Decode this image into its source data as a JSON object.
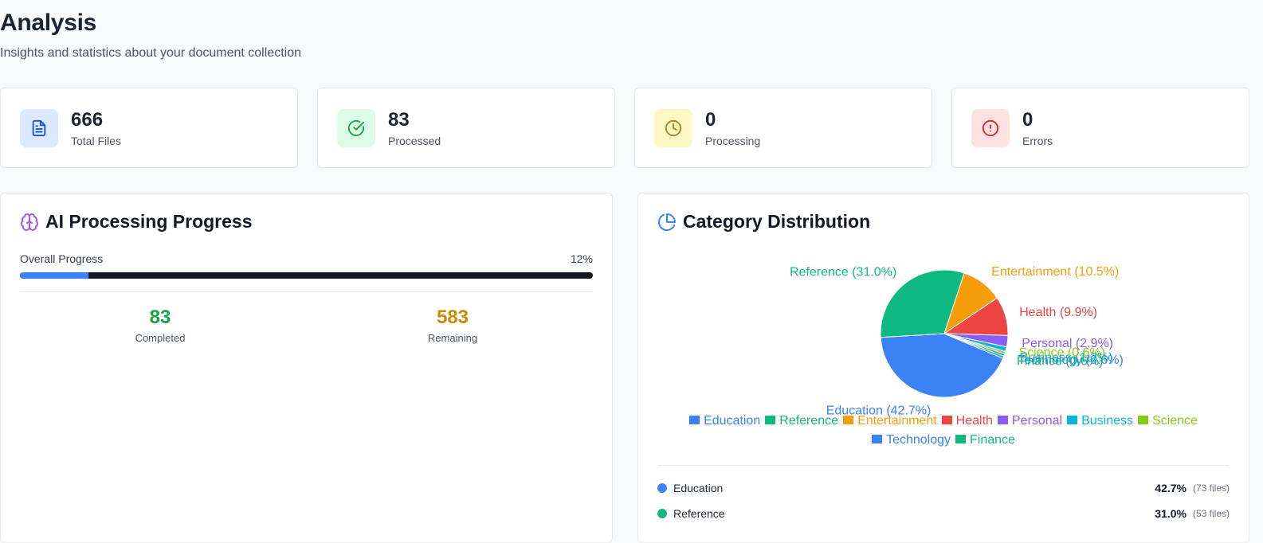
{
  "page": {
    "title": "Analysis",
    "subtitle": "Insights and statistics about your document collection"
  },
  "stats": [
    {
      "value": "666",
      "label": "Total Files",
      "icon": "file-text-icon",
      "color": "#1d4ed8",
      "bg": "#dbeafe"
    },
    {
      "value": "83",
      "label": "Processed",
      "icon": "check-circle-icon",
      "color": "#16a34a",
      "bg": "#dcfce7"
    },
    {
      "value": "0",
      "label": "Processing",
      "icon": "clock-icon",
      "color": "#b7791f",
      "bg": "#fef9c3"
    },
    {
      "value": "0",
      "label": "Errors",
      "icon": "alert-circle-icon",
      "color": "#dc2626",
      "bg": "#fee2e2"
    }
  ],
  "progress_panel": {
    "title": "AI Processing Progress",
    "icon": "brain-icon",
    "overall_label": "Overall Progress",
    "percent_text": "12%",
    "fraction": 0.12,
    "completed": {
      "value": "83",
      "label": "Completed",
      "color": "#16a34a"
    },
    "remaining": {
      "value": "583",
      "label": "Remaining",
      "color": "#ca8a04"
    }
  },
  "category_panel": {
    "title": "Category Distribution",
    "icon": "pie-chart-icon",
    "accent": "#3b82f6"
  },
  "chart_data": {
    "type": "pie",
    "categories": [
      "Education",
      "Reference",
      "Entertainment",
      "Health",
      "Personal",
      "Business",
      "Science",
      "Technology",
      "Finance"
    ],
    "values": [
      42.7,
      31.0,
      10.5,
      9.9,
      2.9,
      1.2,
      0.6,
      0.6,
      0.6
    ],
    "slice_labels": [
      "Education (42.7%)",
      "Reference (31.0%)",
      "Entertainment (10.5%)",
      "Health (9.9%)",
      "Personal (2.9%)",
      "Business (1.2%)",
      "Science (0.6%)",
      "Technology (0.6%)",
      "Finance (0.6%)"
    ],
    "colors": [
      "#3b82f6",
      "#10b981",
      "#f59e0b",
      "#ef4444",
      "#8b5cf6",
      "#06b6d4",
      "#84cc16",
      "#3b82f6",
      "#10b981"
    ],
    "legend": [
      "Education",
      "Reference",
      "Entertainment",
      "Health",
      "Personal",
      "Business",
      "Science",
      "Technology",
      "Finance"
    ],
    "legend_placement": "bottom"
  },
  "category_list": [
    {
      "name": "Education",
      "percent": "42.7%",
      "files": "(73 files)",
      "color": "#3b82f6"
    },
    {
      "name": "Reference",
      "percent": "31.0%",
      "files": "(53 files)",
      "color": "#10b981"
    }
  ]
}
